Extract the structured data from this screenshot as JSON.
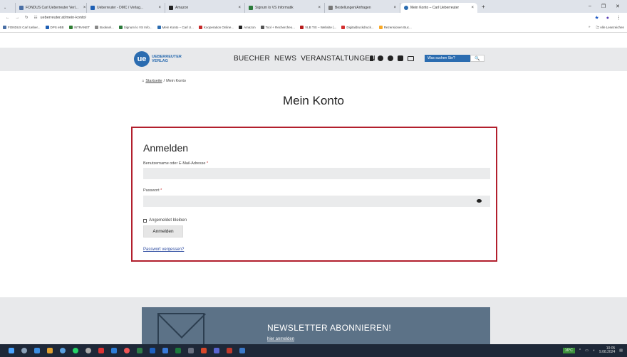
{
  "browser": {
    "tabs": [
      {
        "label": "FONDUS Carl Ueberreuter Verl...",
        "color": "#4a6fa5",
        "active": false
      },
      {
        "label": "Ueberreuter - DMC / Verlag...",
        "color": "#1e5fb4",
        "active": false
      },
      {
        "label": "Amazon",
        "color": "#222222",
        "active": false
      },
      {
        "label": "Signum lo VS Informatik",
        "color": "#2a7a3a",
        "active": false
      },
      {
        "label": "Bestellungen/Anfragen",
        "color": "#777777",
        "active": false
      },
      {
        "label": "Mein Konto – Carl Ueberreuter",
        "color": "#2b6cb0",
        "active": true
      }
    ],
    "new_tab": "+",
    "url": "ueberreuter.at/mein-konto/",
    "bookmarks": [
      {
        "label": "FONDUS Carl Ueber...",
        "color": "#4a6fa5"
      },
      {
        "label": "DPS eBB",
        "color": "#1e5fb4"
      },
      {
        "label": "INTRANET",
        "color": "#2e7d32"
      },
      {
        "label": "Booksel...",
        "color": "#888888"
      },
      {
        "label": "Signum lo VS Info...",
        "color": "#2a7a3a"
      },
      {
        "label": "Mein Konto – Carl U...",
        "color": "#2b6cb0"
      },
      {
        "label": "Kooperation Online...",
        "color": "#c62828"
      },
      {
        "label": "Amazon",
        "color": "#222222"
      },
      {
        "label": "Tool + Rechercheo...",
        "color": "#555555"
      },
      {
        "label": "VLB TIX – Website (...",
        "color": "#b71c1c"
      },
      {
        "label": "Digitaldruckdruck...",
        "color": "#d32f2f"
      },
      {
        "label": "Rezensionen Buc...",
        "color": "#f9a825"
      }
    ],
    "bookmarks_more": "»",
    "all_bookmarks": "Alle Lesezeichen"
  },
  "header": {
    "logo_mark": "ue",
    "logo_line1": "UEBERREUTER",
    "logo_line2": "VERLAG",
    "nav": [
      "BUECHER",
      "NEWS",
      "VERANSTALTUNGEN"
    ],
    "search_placeholder": "Was suchen Sie?",
    "search_button": "🔍"
  },
  "breadcrumb": {
    "home": "Startseite",
    "separator": "/",
    "current": "Mein Konto"
  },
  "page": {
    "title": "Mein Konto"
  },
  "login": {
    "heading": "Anmelden",
    "username_label": "Benutzername oder E-Mail-Adresse",
    "password_label": "Passwort",
    "required_mark": "*",
    "remember_label": "Angemeldet bleiben",
    "submit_label": "Anmelden",
    "forgot_label": "Passwort vergessen?"
  },
  "newsletter": {
    "title": "NEWSLETTER ABONNIEREN!",
    "link": "hier anmelden"
  },
  "taskbar": {
    "weather": "16°C",
    "time": "10:05",
    "date": "9.08.2024"
  },
  "colors": {
    "brand_blue": "#2b6cb0",
    "login_border": "#b21f2d",
    "header_bg": "#e8e9eb",
    "newsletter_bg": "#5c7287"
  }
}
